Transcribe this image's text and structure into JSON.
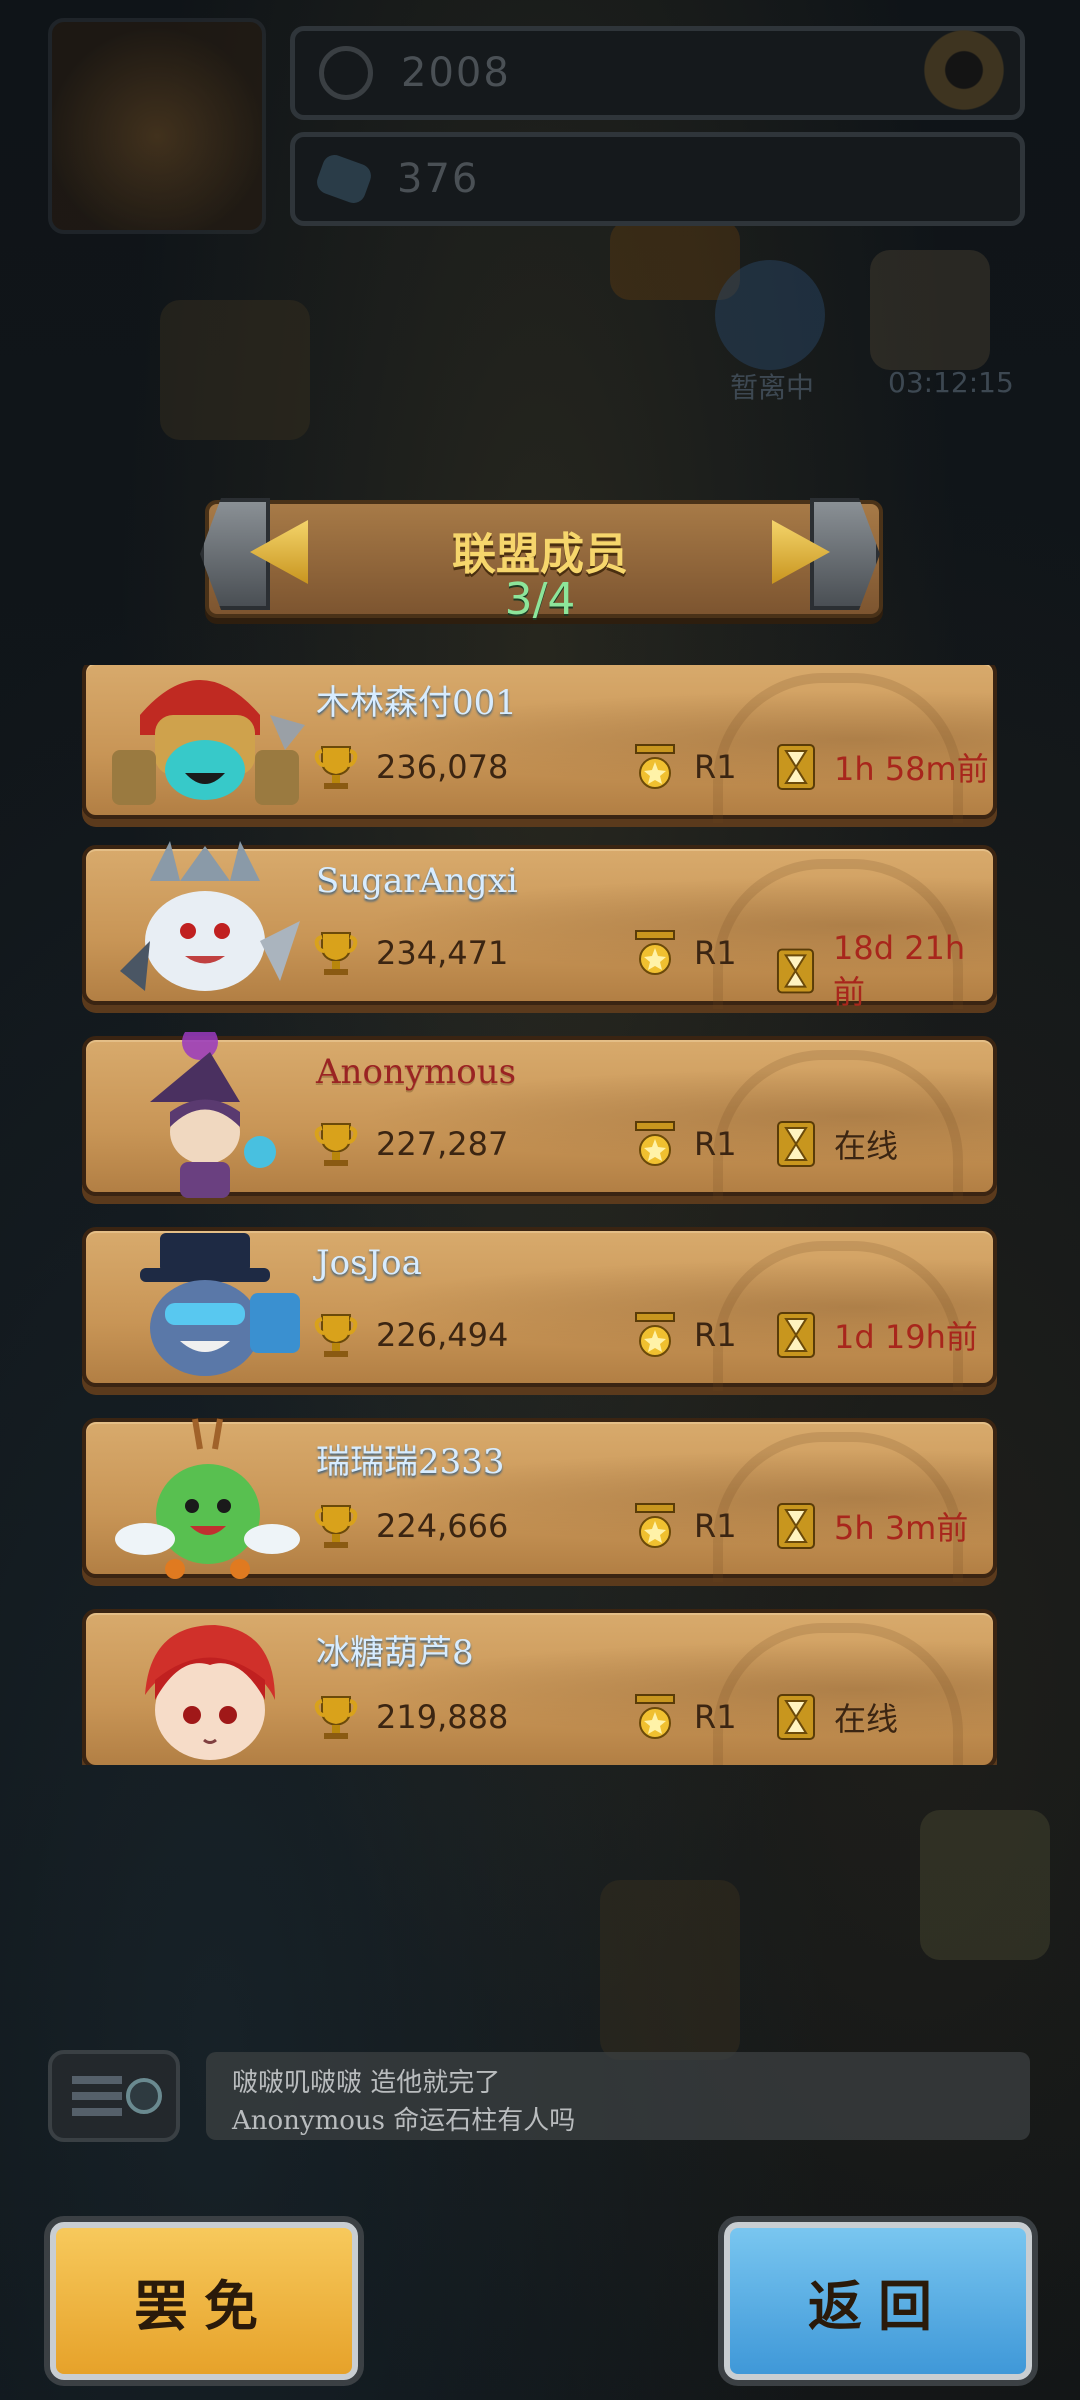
{
  "hud": {
    "trophies": "2008",
    "gems": "376",
    "status_away": "暂离中",
    "timer": "03:12:15"
  },
  "panel": {
    "title": "联盟成员",
    "count": "3/4"
  },
  "members": [
    {
      "name": "木林森付001",
      "name_color": "blue",
      "trophies": "236,078",
      "rank": "R1",
      "last_seen": "1h 58m前",
      "online": false
    },
    {
      "name": "SugarAngxi",
      "name_color": "blue",
      "trophies": "234,471",
      "rank": "R1",
      "last_seen": "18d 21h前",
      "online": false
    },
    {
      "name": "Anonymous",
      "name_color": "red",
      "trophies": "227,287",
      "rank": "R1",
      "last_seen": "在线",
      "online": true
    },
    {
      "name": "JosJoa",
      "name_color": "blue",
      "trophies": "226,494",
      "rank": "R1",
      "last_seen": "1d 19h前",
      "online": false
    },
    {
      "name": "瑞瑞瑞2333",
      "name_color": "blue",
      "trophies": "224,666",
      "rank": "R1",
      "last_seen": "5h 3m前",
      "online": false
    },
    {
      "name": "冰糖葫芦8",
      "name_color": "blue",
      "trophies": "219,888",
      "rank": "R1",
      "last_seen": "在线",
      "online": true
    }
  ],
  "chat": {
    "line1": "啵啵叽啵啵  造他就完了",
    "line2": "Anonymous  命运石柱有人吗"
  },
  "buttons": {
    "kick": "罢免",
    "back": "返回"
  }
}
